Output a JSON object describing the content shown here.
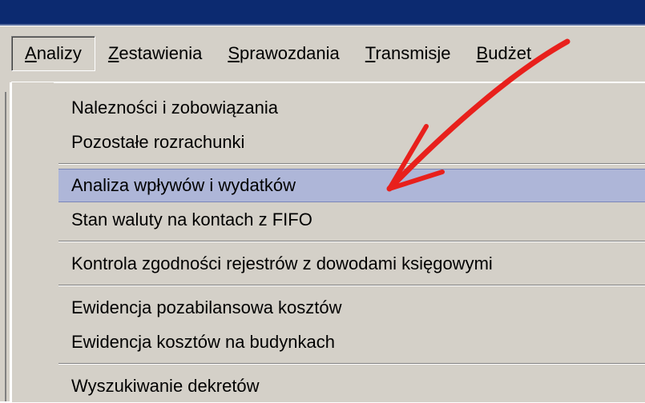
{
  "menubar": {
    "items": [
      {
        "mnemonic": "A",
        "rest": "nalizy",
        "active": true
      },
      {
        "mnemonic": "Z",
        "rest": "estawienia"
      },
      {
        "mnemonic": "S",
        "rest": "prawozdania"
      },
      {
        "mnemonic": "T",
        "rest": "ransmisje"
      },
      {
        "mnemonic": "B",
        "rest": "udżet"
      }
    ]
  },
  "dropdown": {
    "items": [
      {
        "label": "Nalezności i zobowiązania"
      },
      {
        "label": "Pozostałe rozrachunki"
      },
      {
        "label": "Analiza wpływów i wydatków"
      },
      {
        "label": "Stan waluty na kontach z FIFO"
      },
      {
        "label": "Kontrola zgodności rejestrów z dowodami księgowymi"
      },
      {
        "label": "Ewidencja pozabilansowa kosztów"
      },
      {
        "label": "Ewidencja kosztów na budynkach"
      },
      {
        "label": "Wyszukiwanie dekretów"
      }
    ],
    "selected_index": 2
  },
  "colors": {
    "title_bar": "#0c2a70",
    "menu_bg": "#d4d0c8",
    "selection": "#aeb6d8",
    "annotation_arrow": "#e8201c"
  }
}
